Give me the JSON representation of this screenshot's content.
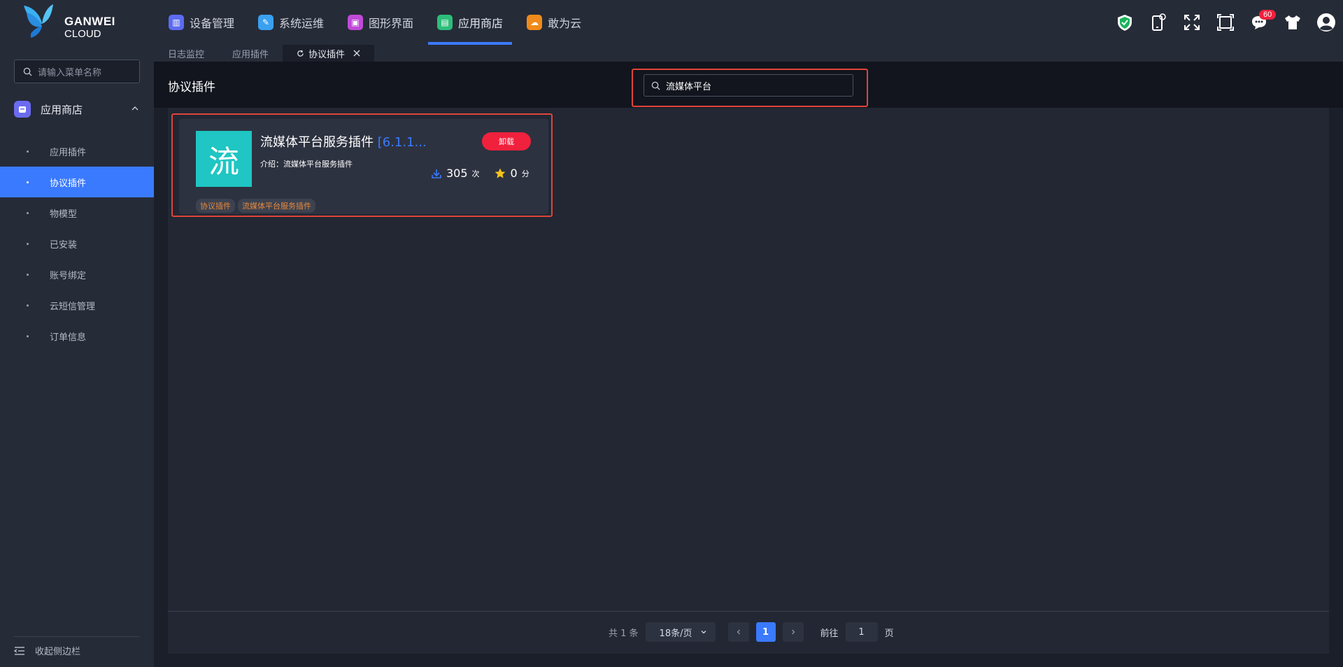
{
  "brand": {
    "line1": "GANWEI",
    "line2": "CLOUD"
  },
  "nav": [
    {
      "label": "设备管理",
      "icon": "device-icon",
      "color": "#5c6bf0"
    },
    {
      "label": "系统运维",
      "icon": "wrench-icon",
      "color": "#3aa0f0"
    },
    {
      "label": "图形界面",
      "icon": "graphics-icon",
      "color": "#c04ad8"
    },
    {
      "label": "应用商店",
      "icon": "store-icon",
      "color": "#2dbd7a",
      "active": true
    },
    {
      "label": "敢为云",
      "icon": "cloud-icon",
      "color": "#f08a1a"
    }
  ],
  "top_icons": [
    "shield-icon",
    "phone-icon",
    "fullscreen-icon",
    "frame-icon",
    "chat-icon",
    "shirt-icon",
    "user-avatar-icon"
  ],
  "notification_count": "60",
  "sidebar": {
    "search_placeholder": "请输入菜单名称",
    "group_label": "应用商店",
    "items": [
      {
        "label": "应用插件"
      },
      {
        "label": "协议插件",
        "active": true
      },
      {
        "label": "物模型"
      },
      {
        "label": "已安装"
      },
      {
        "label": "账号绑定"
      },
      {
        "label": "云短信管理"
      },
      {
        "label": "订单信息"
      }
    ],
    "collapse_label": "收起侧边栏"
  },
  "tabs": [
    {
      "label": "日志监控"
    },
    {
      "label": "应用插件"
    },
    {
      "label": "协议插件",
      "active": true
    }
  ],
  "page": {
    "title": "协议插件",
    "search_value": "流媒体平台"
  },
  "plugin": {
    "icon_char": "流",
    "name": "流媒体平台服务插件",
    "version": "[6.1.1...",
    "desc_label": "介绍：",
    "desc": "流媒体平台服务插件",
    "uninstall_label": "卸载",
    "downloads": "305",
    "downloads_unit": "次",
    "rating": "0",
    "rating_unit": "分",
    "tags": [
      "协议插件",
      "流媒体平台服务插件"
    ]
  },
  "pagination": {
    "total_text": "共 1 条",
    "page_size": "18条/页",
    "current_page": "1",
    "goto_label": "前往",
    "goto_value": "1",
    "page_unit": "页"
  }
}
